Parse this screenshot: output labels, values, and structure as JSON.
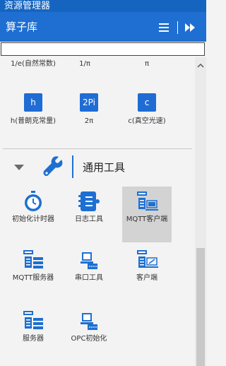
{
  "window": {
    "title": "资源管理器"
  },
  "panel": {
    "title": "算子库"
  },
  "search": {
    "value": ""
  },
  "constants": {
    "row1": [
      "1/e(自然常数)",
      "1/π",
      "π"
    ],
    "row2": [
      {
        "glyph": "h",
        "label": "h(普朗克常量)"
      },
      {
        "glyph": "2Pi",
        "label": "2π"
      },
      {
        "glyph": "c",
        "label": "c(真空光速)"
      }
    ]
  },
  "section": {
    "title": "通用工具"
  },
  "tools": [
    {
      "label": "初始化计时器",
      "icon": "stopwatch-icon"
    },
    {
      "label": "日志工具",
      "icon": "log-icon"
    },
    {
      "label": "MQTT客户端",
      "icon": "tcp-client-icon",
      "selected": true
    },
    {
      "label": "MQTT服务器",
      "icon": "tcp-server-icon"
    },
    {
      "label": "串口工具",
      "icon": "serial-port-icon"
    },
    {
      "label": "客户端",
      "icon": "client-icon"
    },
    {
      "label": "服务器",
      "icon": "server-icon"
    },
    {
      "label": "OPC初始化",
      "icon": "opc-icon"
    }
  ],
  "colors": {
    "accent": "#1e6fd1",
    "title_bar": "#1565c0",
    "selected": "#d3d3d3"
  }
}
